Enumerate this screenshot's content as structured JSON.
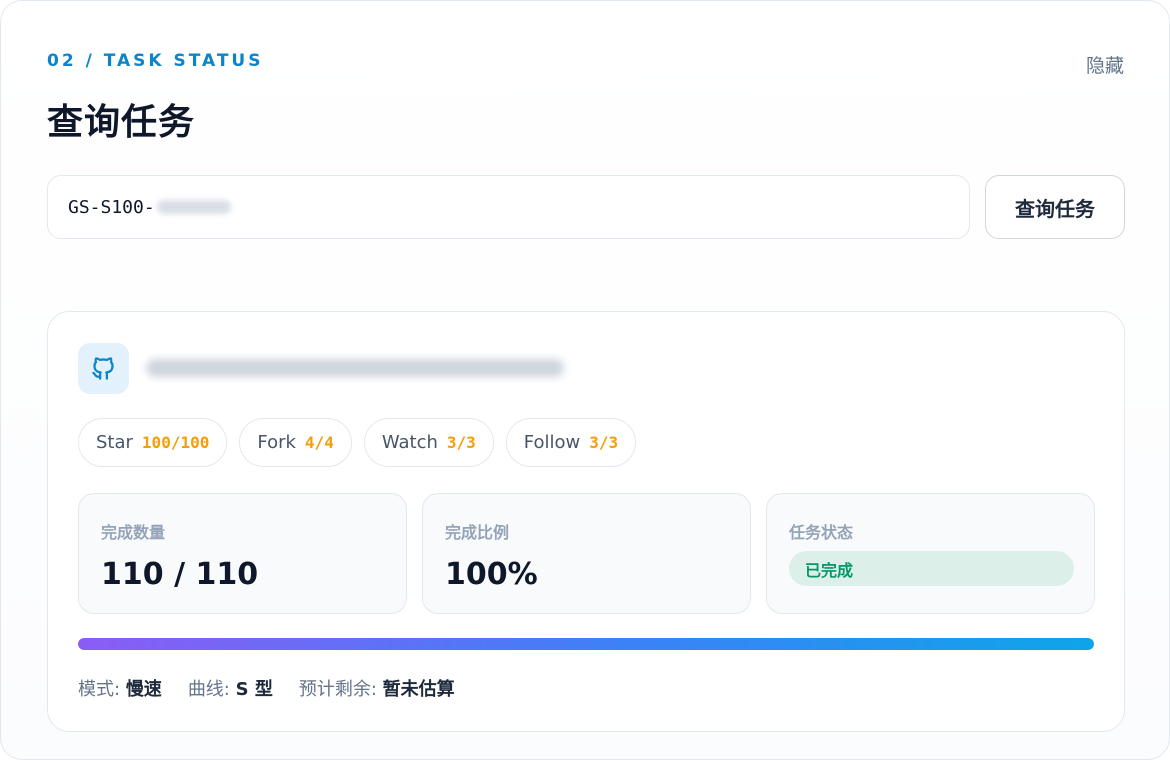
{
  "header": {
    "eyebrow": "02 / TASK STATUS",
    "title": "查询任务",
    "hide_label": "隐藏"
  },
  "search": {
    "value": "GS-S100-",
    "button_label": "查询任务"
  },
  "task": {
    "repo_icon": "github-icon",
    "chips": [
      {
        "label": "Star",
        "value": "100/100"
      },
      {
        "label": "Fork",
        "value": "4/4"
      },
      {
        "label": "Watch",
        "value": "3/3"
      },
      {
        "label": "Follow",
        "value": "3/3"
      }
    ],
    "stats": {
      "count_label": "完成数量",
      "count_value": "110 / 110",
      "ratio_label": "完成比例",
      "ratio_value": "100%",
      "status_label": "任务状态",
      "status_value": "已完成"
    },
    "progress_percent": 100,
    "meta": {
      "mode_label": "模式:",
      "mode_value": "慢速",
      "curve_label": "曲线:",
      "curve_value": "S 型",
      "eta_label": "预计剩余:",
      "eta_value": "暂未估算"
    }
  },
  "colors": {
    "accent": "#0b84c9",
    "chip_value": "#f59e0b",
    "success": "#059669"
  }
}
